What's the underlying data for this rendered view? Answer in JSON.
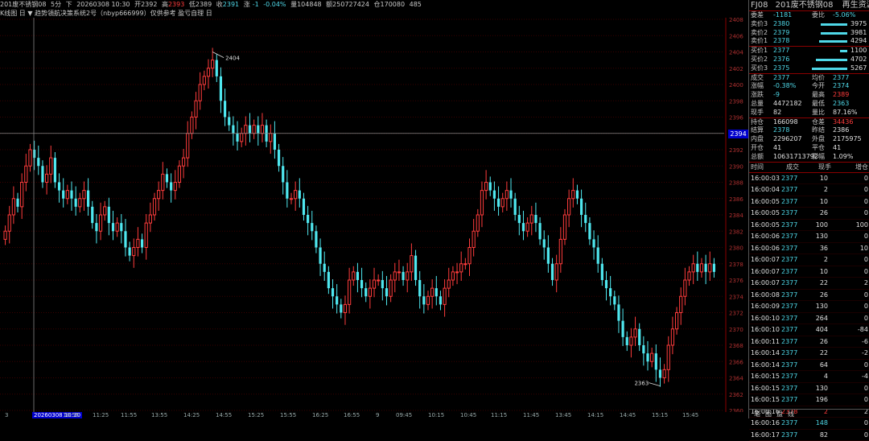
{
  "topbar": {
    "contract": "201废不锈钢08",
    "period": "5分",
    "direction": "下",
    "datetime": "20260308 10:30",
    "open_label": "开",
    "open": "2392",
    "high_label": "高",
    "high": "2393",
    "low_label": "低",
    "low": "2389",
    "close_label": "收",
    "close": "2391",
    "change_label": "涨",
    "change": "-1",
    "change_pct": "-0.04%",
    "volume_label": "量",
    "volume": "104848",
    "amount_label": "额",
    "amount": "250727424",
    "oi_label": "仓",
    "oi": "170080",
    "oi_change": "485"
  },
  "subbar": {
    "text": "K线图 日 ▼  趋势領航决策系统2号（nbyp666999）仅供参考 盈亏自理 日"
  },
  "chart": {
    "yticks": [
      "2408",
      "2406",
      "2404",
      "2402",
      "2400",
      "2398",
      "2396",
      "2394",
      "2392",
      "2390",
      "2388",
      "2386",
      "2384",
      "2382",
      "2380",
      "2378",
      "2376",
      "2374",
      "2372",
      "2370",
      "2368",
      "2366",
      "2364",
      "2362",
      "2360"
    ],
    "ytick_values": [
      2408,
      2406,
      2404,
      2402,
      2400,
      2398,
      2396,
      2394,
      2392,
      2390,
      2388,
      2386,
      2384,
      2382,
      2380,
      2378,
      2376,
      2374,
      2372,
      2370,
      2368,
      2366,
      2364,
      2362,
      2360
    ],
    "ymax": 2408,
    "ymin": 2360,
    "crosshair_price": "2394",
    "crosshair_value": 2394,
    "max_label": "2404",
    "min_label": "2363",
    "up_color": "#ff3c3c",
    "down_color": "#4fe8f0",
    "closes": [
      2382,
      2384,
      2386,
      2385,
      2388,
      2390,
      2392,
      2391,
      2390,
      2388,
      2389,
      2391,
      2388,
      2387,
      2386,
      2387,
      2386,
      2385,
      2386,
      2387,
      2385,
      2383,
      2382,
      2384,
      2385,
      2383,
      2382,
      2383,
      2382,
      2380,
      2379,
      2380,
      2381,
      2380,
      2383,
      2384,
      2386,
      2387,
      2389,
      2388,
      2387,
      2388,
      2390,
      2391,
      2394,
      2396,
      2398,
      2400,
      2401,
      2402,
      2403,
      2401,
      2398,
      2396,
      2395,
      2394,
      2393,
      2394,
      2395,
      2394,
      2395,
      2394,
      2395,
      2393,
      2394,
      2392,
      2390,
      2388,
      2386,
      2386,
      2387,
      2386,
      2384,
      2383,
      2382,
      2380,
      2378,
      2377,
      2375,
      2374,
      2373,
      2372,
      2373,
      2376,
      2377,
      2376,
      2375,
      2374,
      2375,
      2376,
      2376,
      2375,
      2374,
      2376,
      2377,
      2377,
      2376,
      2377,
      2379,
      2376,
      2374,
      2373,
      2374,
      2375,
      2374,
      2373,
      2375,
      2376,
      2377,
      2377,
      2378,
      2378,
      2380,
      2382,
      2384,
      2387,
      2388,
      2387,
      2386,
      2385,
      2386,
      2387,
      2386,
      2384,
      2383,
      2382,
      2383,
      2384,
      2383,
      2381,
      2380,
      2378,
      2376,
      2378,
      2381,
      2384,
      2386,
      2387,
      2386,
      2384,
      2383,
      2381,
      2380,
      2378,
      2376,
      2375,
      2374,
      2373,
      2371,
      2369,
      2368,
      2369,
      2370,
      2368,
      2367,
      2366,
      2367,
      2365,
      2364,
      2365,
      2368,
      2370,
      2372,
      2374,
      2376,
      2377,
      2378,
      2377,
      2378,
      2377,
      2378,
      2377
    ]
  },
  "xaxis": {
    "highlight": "20260308 10:30",
    "labels": [
      "3",
      "10:55",
      "11:25",
      "11:55",
      "13:55",
      "14:25",
      "14:55",
      "15:25",
      "15:55",
      "16:25",
      "16:55",
      "9",
      "09:45",
      "10:15",
      "10:45",
      "11:15",
      "11:45",
      "13:45",
      "14:15",
      "14:45",
      "15:15",
      "15:45"
    ]
  },
  "panel": {
    "code": "FJ08",
    "name": "201废不锈钢08",
    "source": "再生资源",
    "weicha_label": "委差",
    "weicha": "-1181",
    "weibi_label": "委比",
    "weibi": "-5.06%",
    "asks": [
      {
        "label": "卖价3",
        "price": "2380",
        "vol": "3975",
        "bar": 0.75
      },
      {
        "label": "卖价2",
        "price": "2379",
        "vol": "3981",
        "bar": 0.75
      },
      {
        "label": "卖价1",
        "price": "2378",
        "vol": "4294",
        "bar": 0.8
      }
    ],
    "bids": [
      {
        "label": "买价1",
        "price": "2377",
        "vol": "1100",
        "bar": 0.2
      },
      {
        "label": "买价2",
        "price": "2376",
        "vol": "4702",
        "bar": 0.88
      },
      {
        "label": "买价3",
        "price": "2375",
        "vol": "5267",
        "bar": 1.0
      }
    ],
    "stats": [
      {
        "l1": "成交",
        "v1": "2377",
        "c1": "cyan",
        "l2": "均价",
        "v2": "2377",
        "c2": "cyan"
      },
      {
        "l1": "涨幅",
        "v1": "-0.38%",
        "c1": "cyan",
        "l2": "今开",
        "v2": "2374",
        "c2": "cyan"
      },
      {
        "l1": "涨跌",
        "v1": "-9",
        "c1": "cyan",
        "l2": "最高",
        "v2": "2389",
        "c2": "red"
      },
      {
        "l1": "总量",
        "v1": "4472182",
        "c1": "white",
        "l2": "最低",
        "v2": "2363",
        "c2": "cyan"
      },
      {
        "l1": "现手",
        "v1": "82",
        "c1": "white",
        "l2": "量比",
        "v2": "87.16%",
        "c2": "white"
      }
    ],
    "stats2": [
      {
        "l1": "持仓",
        "v1": "166098",
        "c1": "white",
        "l2": "仓差",
        "v2": "34436",
        "c2": "red"
      },
      {
        "l1": "结算",
        "v1": "2378",
        "c1": "cyan",
        "l2": "昨结",
        "v2": "2386",
        "c2": "white"
      },
      {
        "l1": "内盘",
        "v1": "2296207",
        "c1": "white",
        "l2": "外盘",
        "v2": "2175975",
        "c2": "white"
      },
      {
        "l1": "开仓",
        "v1": "41",
        "c1": "white",
        "l2": "平仓",
        "v2": "41",
        "c2": "white"
      },
      {
        "l1": "总额",
        "v1": "10631713792",
        "c1": "white",
        "l2": "影幅",
        "v2": "1.09%",
        "c2": "white"
      }
    ],
    "trades_head": {
      "time": "时间",
      "price": "成交",
      "vol": "现手",
      "oi": "增仓"
    },
    "trades": [
      {
        "time": "16:00:03",
        "price": "2377",
        "pc": "cyan",
        "vol": "10",
        "oi": "0"
      },
      {
        "time": "16:00:04",
        "price": "2377",
        "pc": "cyan",
        "vol": "2",
        "oi": "0"
      },
      {
        "time": "16:00:05",
        "price": "2377",
        "pc": "cyan",
        "vol": "10",
        "oi": "0"
      },
      {
        "time": "16:00:05",
        "price": "2377",
        "pc": "cyan",
        "vol": "26",
        "oi": "0"
      },
      {
        "time": "16:00:05",
        "price": "2377",
        "pc": "cyan",
        "vol": "100",
        "oi": "100"
      },
      {
        "time": "16:00:06",
        "price": "2377",
        "pc": "cyan",
        "vol": "130",
        "oi": "0"
      },
      {
        "time": "16:00:06",
        "price": "2377",
        "pc": "cyan",
        "vol": "36",
        "oi": "10"
      },
      {
        "time": "16:00:07",
        "price": "2377",
        "pc": "cyan",
        "vol": "2",
        "oi": "0"
      },
      {
        "time": "16:00:07",
        "price": "2377",
        "pc": "cyan",
        "vol": "10",
        "oi": "0"
      },
      {
        "time": "16:00:07",
        "price": "2377",
        "pc": "cyan",
        "vol": "22",
        "oi": "2"
      },
      {
        "time": "16:00:08",
        "price": "2377",
        "pc": "cyan",
        "vol": "26",
        "oi": "0"
      },
      {
        "time": "16:00:09",
        "price": "2377",
        "pc": "cyan",
        "vol": "130",
        "oi": "0"
      },
      {
        "time": "16:00:10",
        "price": "2377",
        "pc": "cyan",
        "vol": "264",
        "oi": "0"
      },
      {
        "time": "16:00:10",
        "price": "2377",
        "pc": "cyan",
        "vol": "404",
        "oi": "-84"
      },
      {
        "time": "16:00:11",
        "price": "2377",
        "pc": "cyan",
        "vol": "26",
        "oi": "-6"
      },
      {
        "time": "16:00:14",
        "price": "2377",
        "pc": "cyan",
        "vol": "22",
        "oi": "-2"
      },
      {
        "time": "16:00:14",
        "price": "2377",
        "pc": "cyan",
        "vol": "64",
        "oi": "0"
      },
      {
        "time": "16:00:15",
        "price": "2377",
        "pc": "cyan",
        "vol": "4",
        "oi": "-4"
      },
      {
        "time": "16:00:15",
        "price": "2377",
        "pc": "cyan",
        "vol": "130",
        "oi": "0"
      },
      {
        "time": "16:00:15",
        "price": "2377",
        "pc": "cyan",
        "vol": "196",
        "oi": "0"
      },
      {
        "time": "16:00:16",
        "price": "2378",
        "pc": "red",
        "vol": "2",
        "oi": "2"
      },
      {
        "time": "16:00:16",
        "price": "2377",
        "pc": "cyan",
        "vol": "148",
        "oi": "0"
      },
      {
        "time": "16:00:17",
        "price": "2377",
        "pc": "cyan",
        "vol": "82",
        "oi": "0"
      }
    ],
    "bottom_tabs": [
      "笔",
      "图",
      "盘",
      "线"
    ]
  }
}
